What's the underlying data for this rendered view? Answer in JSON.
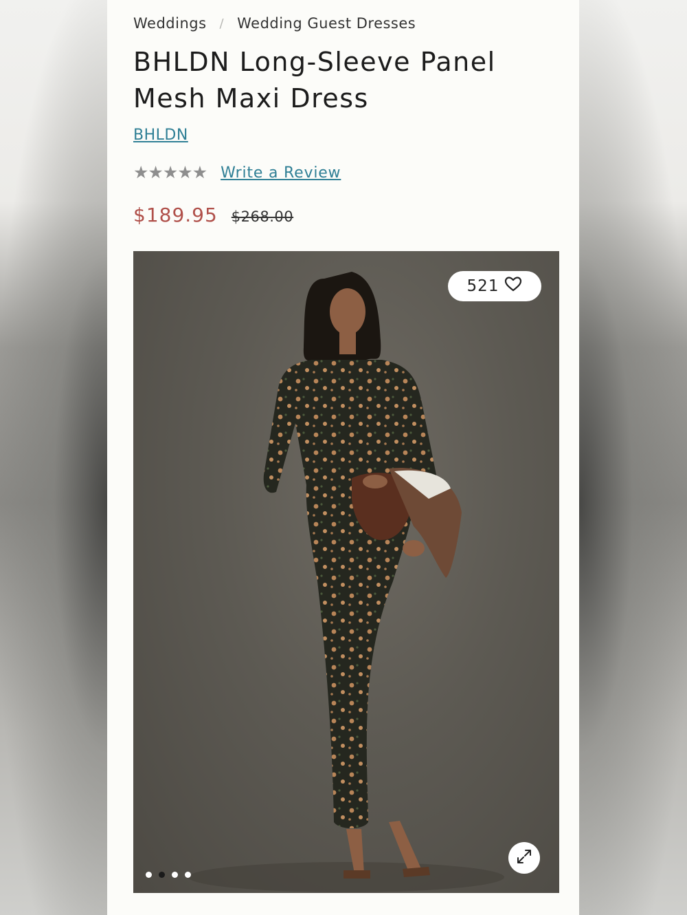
{
  "breadcrumb": {
    "items": [
      "Weddings",
      "Wedding Guest Dresses"
    ],
    "separator": "/"
  },
  "product": {
    "title": "BHLDN Long-Sleeve Panel Mesh Maxi Dress",
    "brand": "BHLDN",
    "rating": {
      "stars_filled": 5,
      "stars_total": 5,
      "review_link": "Write a Review"
    },
    "price": {
      "sale": "$189.95",
      "original": "$268.00"
    }
  },
  "gallery": {
    "like_count": "521",
    "heart_icon": "heart-outline-icon",
    "expand_icon": "expand-arrows-icon",
    "slides_total": 4,
    "active_slide": 2
  },
  "colors": {
    "link": "#2f7f95",
    "sale_price": "#b0504a",
    "stars": "#8e8e8e"
  }
}
